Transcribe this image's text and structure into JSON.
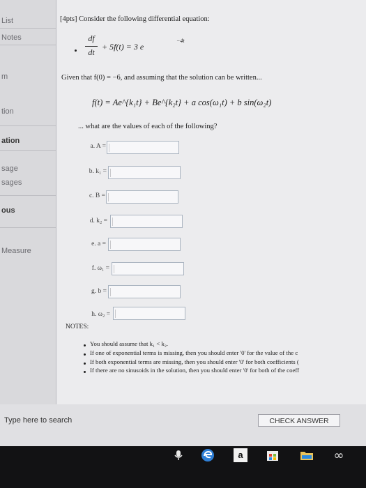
{
  "sidebar": {
    "items": [
      "List",
      "Notes",
      "m",
      "tion",
      "ation",
      "sage",
      "sages",
      "ous",
      "Measure"
    ]
  },
  "question": {
    "header": "[4pts] Consider the following differential equation:",
    "equation": {
      "numerator": "df",
      "denominator": "dt",
      "rest": "+ 5f(t)  =  3 e",
      "exponent": "−4t"
    },
    "given": "Given that f(0) = −6, and assuming that the solution can be written...",
    "solution_form": "f(t)  =  Ae^{k₁t}  +  Be^{k₂t}  +  a cos(ω₁t)  +  b sin(ω₂t)",
    "prompt": "... what are the values of each of the following?",
    "parts": [
      {
        "label": "a. A ="
      },
      {
        "label": "b. k₁ ="
      },
      {
        "label": "c. B ="
      },
      {
        "label": "d. k₂ ="
      },
      {
        "label": "e. a ="
      },
      {
        "label": "f. ω₁ ="
      },
      {
        "label": "g. b ="
      },
      {
        "label": "h. ω₂ ="
      }
    ],
    "notes_header": "NOTES:",
    "notes": [
      "You should assume that k₁ < k₂.",
      "If one of exponential terms is missing, then you should enter '0' for the value of the c",
      "If both exponential terms are missing, then you should enter '0' for both coefficients (",
      "If there are no sinusoids in the solution, then you should enter '0' for both of the coeff"
    ]
  },
  "bottom": {
    "search_label": "Type here to search",
    "check_label": "CHECK ANSWER"
  },
  "taskbar": {
    "icons": [
      "microphone-icon",
      "edge-icon",
      "amazon-icon",
      "store-icon",
      "folder-icon",
      "infinity-icon"
    ],
    "amazon_label": "a",
    "infinity_label": "∞"
  },
  "colors": {
    "input_border": "#aab4c0",
    "edge_blue": "#2f7fd6",
    "taskbar": "#121214"
  }
}
